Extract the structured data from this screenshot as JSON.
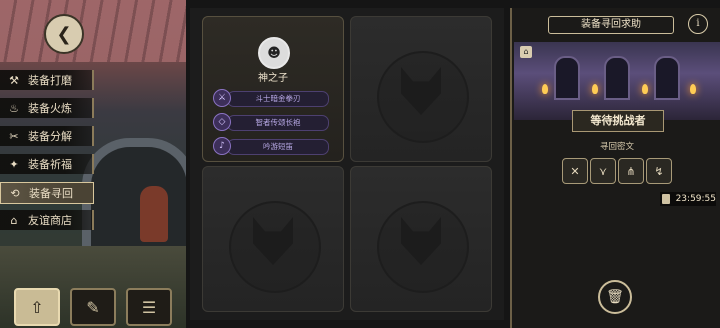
{
  "nav": {
    "back_icon": "back-arrow-icon",
    "items": [
      {
        "label": "装备打磨",
        "icon": "hammer-icon",
        "glyph": "⚒"
      },
      {
        "label": "装备火炼",
        "icon": "flame-icon",
        "glyph": "♨"
      },
      {
        "label": "装备分解",
        "icon": "break-icon",
        "glyph": "✂"
      },
      {
        "label": "装备祈福",
        "icon": "pray-icon",
        "glyph": "✦"
      },
      {
        "label": "装备寻回",
        "icon": "retrieve-icon",
        "glyph": "⟲",
        "active": true
      },
      {
        "label": "友谊商店",
        "icon": "shop-icon",
        "glyph": "⌂"
      }
    ]
  },
  "bottom_tabs": [
    {
      "icon": "upload-icon",
      "glyph": "⇧",
      "active": true
    },
    {
      "icon": "feather-icon",
      "glyph": "✎",
      "active": false
    },
    {
      "icon": "list-icon",
      "glyph": "☰",
      "active": false
    }
  ],
  "hero": {
    "name": "神之子",
    "avatar_icon": "masked-hero-avatar",
    "gear": [
      {
        "label": "斗士暗金拳刃",
        "icon": "fist-blade-icon",
        "glyph": "⚔"
      },
      {
        "label": "智者传颂长袍",
        "icon": "robe-icon",
        "glyph": "◇"
      },
      {
        "label": "吟游短笛",
        "icon": "flute-icon",
        "glyph": "♪"
      }
    ]
  },
  "empty_slots": 3,
  "right_panel": {
    "title": "装备寻回求助",
    "info_label": "i",
    "challenger_label": "等待挑战者",
    "runes_label": "寻回密文",
    "rune_buttons": [
      {
        "icon": "rune-1-icon",
        "glyph": "✕"
      },
      {
        "icon": "rune-2-icon",
        "glyph": "⋎"
      },
      {
        "icon": "rune-3-icon",
        "glyph": "⋔"
      },
      {
        "icon": "rune-4-icon",
        "glyph": "↯"
      }
    ],
    "timer": "23:59:55",
    "trash_icon": "trash-icon"
  }
}
